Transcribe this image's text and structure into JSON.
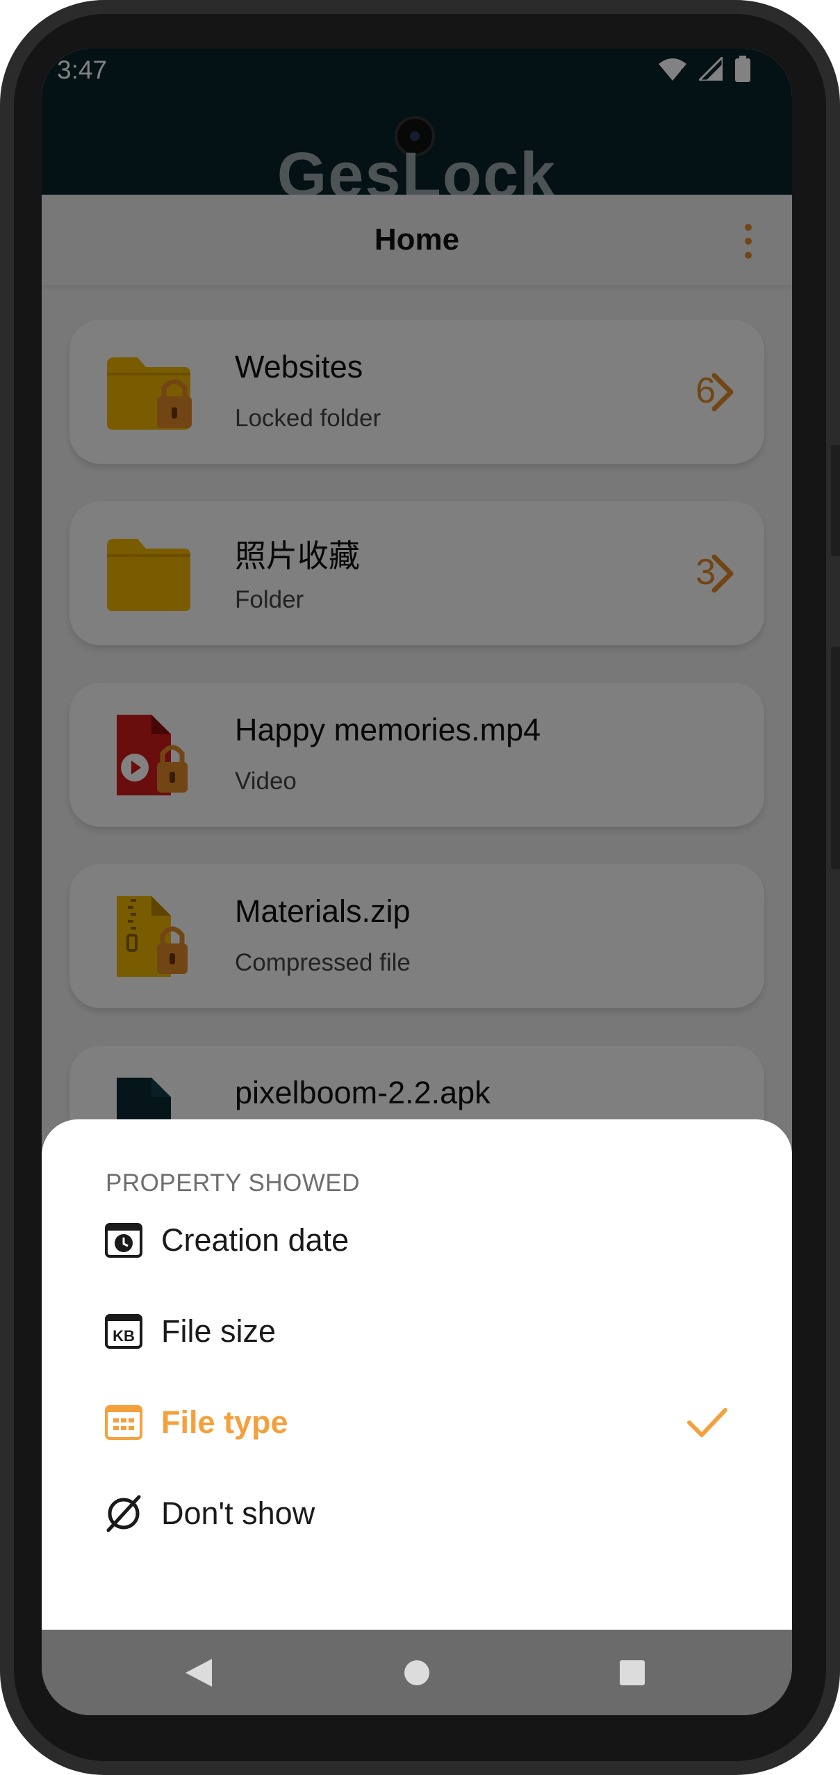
{
  "status_bar": {
    "time": "3:47"
  },
  "app": {
    "logo": "GesLock"
  },
  "toolbar": {
    "title": "Home",
    "more_icon": "more-vert-icon"
  },
  "files": [
    {
      "name": "Websites",
      "subtitle": "Locked folder",
      "count": "6",
      "icon": "locked-folder-icon"
    },
    {
      "name": "照片收藏",
      "subtitle": "Folder",
      "count": "3",
      "icon": "folder-icon"
    },
    {
      "name": "Happy memories.mp4",
      "subtitle": "Video",
      "count": "",
      "icon": "locked-video-file-icon"
    },
    {
      "name": "Materials.zip",
      "subtitle": "Compressed file",
      "count": "",
      "icon": "locked-zip-file-icon"
    },
    {
      "name": "pixelboom-2.2.apk",
      "subtitle": "",
      "count": "",
      "icon": "locked-apk-file-icon"
    }
  ],
  "sheet": {
    "title": "PROPERTY SHOWED",
    "options": [
      {
        "label": "Creation date",
        "icon": "calendar-clock-icon",
        "selected": false
      },
      {
        "label": "File size",
        "icon": "kb-icon",
        "selected": false
      },
      {
        "label": "File type",
        "icon": "file-type-icon",
        "selected": true
      },
      {
        "label": "Don't show",
        "icon": "no-show-icon",
        "selected": false
      }
    ]
  },
  "colors": {
    "accent": "#f4a03c",
    "header": "#08242a",
    "folder": "#f0b400",
    "video": "#d11a1a"
  }
}
